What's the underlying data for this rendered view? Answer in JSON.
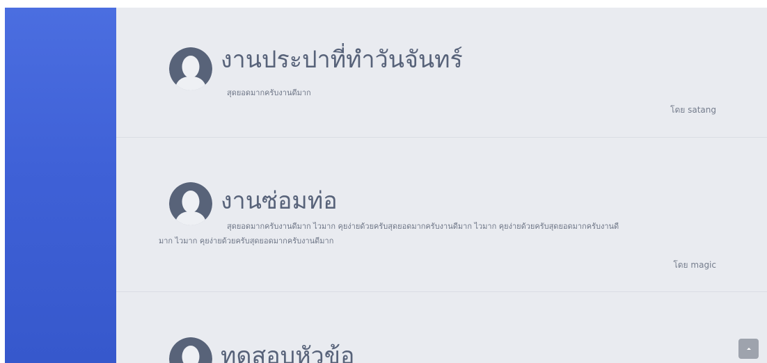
{
  "posts": [
    {
      "title": "งานประปาที่ทำวันจันทร์",
      "description": "สุดยอดมากครับงานดีมาก",
      "author": "โดย satang",
      "avatar_icon": "user-silhouette-icon"
    },
    {
      "title": "งานซ่อมท่อ",
      "description": "สุดยอดมากครับงานดีมาก ไวมาก คุยง่ายด้วยครับสุดยอดมากครับงานดีมาก ไวมาก คุยง่ายด้วยครับสุดยอดมากครับงานดี",
      "description_continued": "มาก ไวมาก คุยง่ายด้วยครับสุดยอดมากครับงานดีมาก",
      "author": "โดย magic",
      "avatar_icon": "user-silhouette-icon"
    },
    {
      "title": "ทดสอบหัวข้อ",
      "avatar_icon": "user-silhouette-icon"
    }
  ],
  "scroll_top_icon": "chevron-up-icon",
  "colors": {
    "sidebar": "#3f61d7",
    "content_background": "#e9ebf0",
    "title": "#576279",
    "avatar": "#586379",
    "scroll_button": "#9ea3ad"
  }
}
